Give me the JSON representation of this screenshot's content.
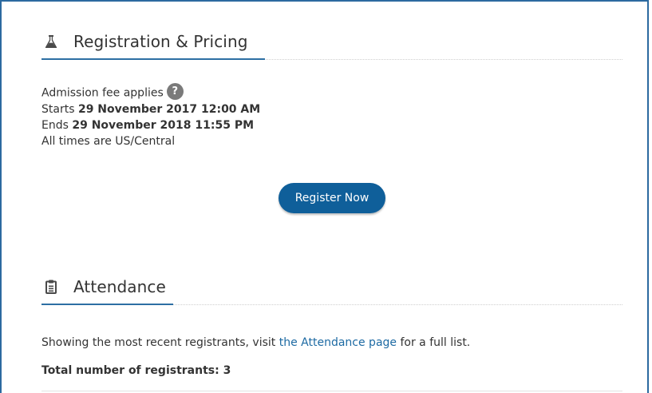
{
  "registration": {
    "title": "Registration & Pricing",
    "icon": "flask-icon",
    "admission_text": "Admission fee applies",
    "help_badge": "?",
    "starts_label": "Starts",
    "starts_value": "29 November 2017 12:00 AM",
    "ends_label": "Ends",
    "ends_value": "29 November 2018 11:55 PM",
    "timezone_note": "All times are US/Central",
    "register_button": "Register Now"
  },
  "attendance": {
    "title": "Attendance",
    "icon": "clipboard-icon",
    "intro_prefix": "Showing the most recent registrants, visit ",
    "intro_link": "the Attendance page",
    "intro_suffix": " for a full list.",
    "total_label": "Total number of registrants: 3"
  },
  "colors": {
    "accent": "#2d6fa3",
    "button": "#0f5f9a",
    "link": "#1d6aa3",
    "frame_border": "#2c6aa0"
  }
}
